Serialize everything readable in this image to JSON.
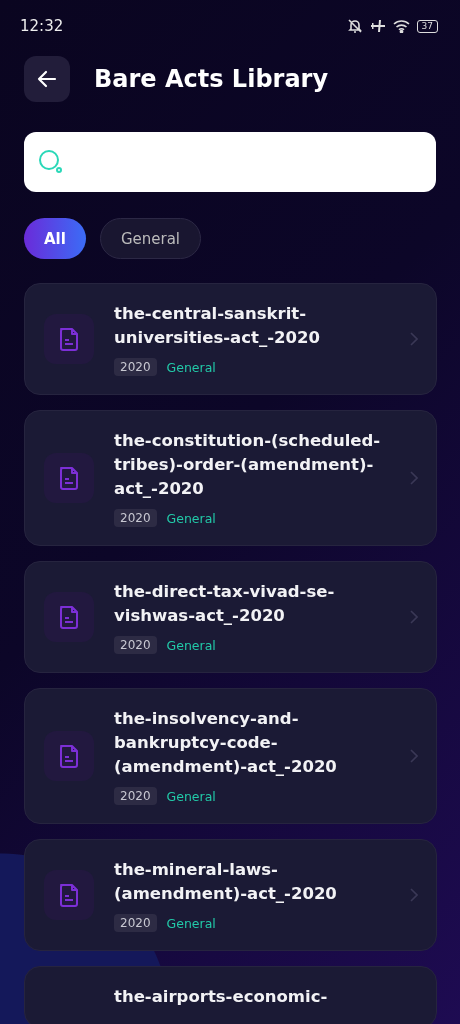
{
  "status_bar": {
    "time": "12:32",
    "battery": "37"
  },
  "header": {
    "title": "Bare Acts Library"
  },
  "filters": [
    {
      "label": "All",
      "selected": true
    },
    {
      "label": "General",
      "selected": false
    }
  ],
  "acts": [
    {
      "title": "the-central-sanskrit-universities-act_-2020",
      "year": "2020",
      "category": "General"
    },
    {
      "title": "the-constitution-(scheduled-tribes)-order-(amendment)-act_-2020",
      "year": "2020",
      "category": "General"
    },
    {
      "title": "the-direct-tax-vivad-se-vishwas-act_-2020",
      "year": "2020",
      "category": "General"
    },
    {
      "title": "the-insolvency-and-bankruptcy-code-(amendment)-act_-2020",
      "year": "2020",
      "category": "General"
    },
    {
      "title": "the-mineral-laws-(amendment)-act_-2020",
      "year": "2020",
      "category": "General"
    },
    {
      "title": "the-airports-economic-"
    }
  ]
}
